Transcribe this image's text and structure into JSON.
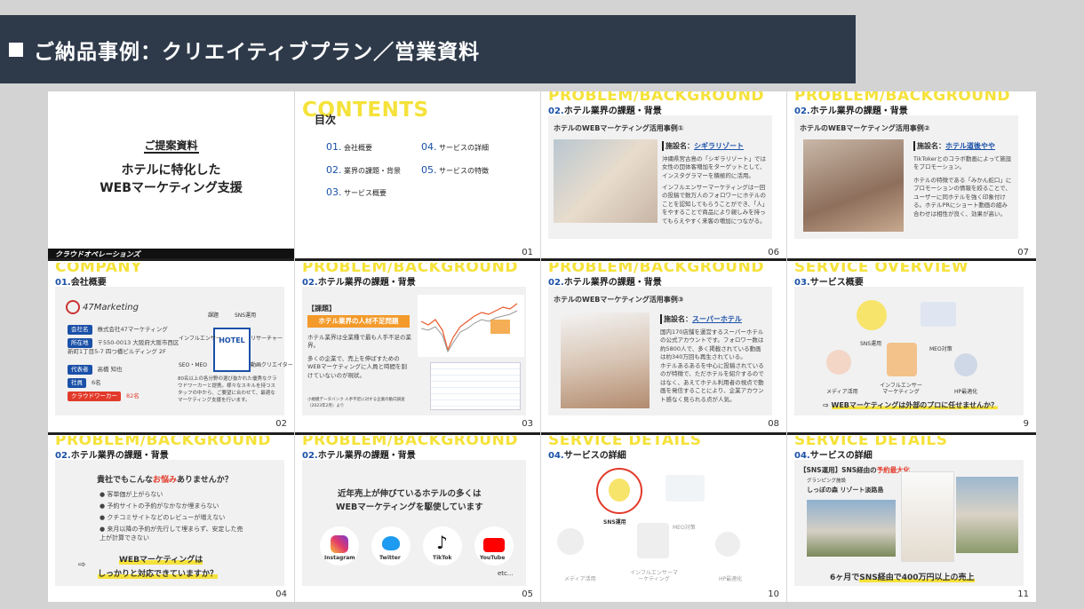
{
  "banner": {
    "title": "ご納品事例：クリエイティブプラン／営業資料"
  },
  "s1": {
    "heading": "ご提案資料",
    "title_line1": "ホテルに特化した",
    "title_line2": "WEBマーケティング支援",
    "logo": "クラウドオペレーションズ"
  },
  "s2": {
    "wm": "CONTENTS",
    "heading": "目次",
    "items": [
      {
        "n": "01.",
        "t": "会社概要"
      },
      {
        "n": "04.",
        "t": "サービスの詳細"
      },
      {
        "n": "02.",
        "t": "業界の課題・背景"
      },
      {
        "n": "05.",
        "t": "サービスの特徴"
      },
      {
        "n": "03.",
        "t": "サービス概要"
      }
    ],
    "page": "01"
  },
  "s3": {
    "wm": "PROBLEM/BACKGROUND",
    "secn": "02.",
    "sec": "ホテル業界の課題・背景",
    "case": "ホテルのWEBマーケティング活用事例①",
    "fname": "施設名：",
    "facility": "シギラリゾート",
    "p1": "沖縄県宮古島の「シギラリゾート」では女性の団体客増加をターゲットとして、インスタグラマーを積極的に活用。",
    "p2": "インフルエンサーマーケティングは一回の投稿で数万人のフォロワーにホテルのことを認知してもらうことができ、「人」をやすることで商品により親しみを持ってもらえやすく来客の増加につながる。",
    "page": "06"
  },
  "s4": {
    "wm": "PROBLEM/BACKGROUND",
    "secn": "02.",
    "sec": "ホテル業界の課題・背景",
    "case": "ホテルのWEBマーケティング活用事例②",
    "fname": "施設名：",
    "facility": "ホテル道後やや",
    "p1": "TikTokerとのコラボ動画によって施設をプロモーション。",
    "p2": "ホテルの特徴である「みかん蛇口」にプロモーションの情報を絞ることで、ユーザーに同ホテルを強く印象付ける。ホテルPRにショート動画の組み合わせは相性が良く、効果が高い。",
    "page": "07"
  },
  "s5": {
    "wm": "COMPANY",
    "secn": "01.",
    "sec": "会社概要",
    "logo": "47Marketing",
    "rows": [
      {
        "k": "会社名",
        "v": "株式会社47マーケティング"
      },
      {
        "k": "所在地",
        "v": "〒550-0013 大阪府大阪市西区新町1丁目5-7 四つ橋ビルディング 2F"
      },
      {
        "k": "代表者",
        "v": "高橋 知也"
      },
      {
        "k": "社員",
        "v": "6名"
      },
      {
        "k": "クラウドワーカー",
        "v": "82名"
      }
    ],
    "hub": "HOTEL",
    "nodes": [
      "課題",
      "SNS運用",
      "インフルエンサー",
      "リサーチャー",
      "SEO・MEO",
      "動画クリエイター"
    ],
    "desc": "80名以上の各分野の選び抜かれた優秀なクラウドワーカーと提携。様々なスキルを持つスタッフの中から、ご要望に合わせて、最適なマーケティング支援を行います。",
    "page": "02"
  },
  "s6": {
    "wm": "PROBLEM/BACKGROUND",
    "secn": "02.",
    "sec": "ホテル業界の課題・背景",
    "tag": "【課題】",
    "issue": "ホテル業界の人材不足問題",
    "p1": "ホテル業界は全業種で最も人手不足の業界。",
    "p2": "多くの企業で、売上を伸ばすためのWEBマーケティングに人員と時間を割けていないのが現状。",
    "source": "小規模データバンク 人手不足に対する企業の動向調査（2023年2月）より",
    "page": "03"
  },
  "s7": {
    "wm": "PROBLEM/BACKGROUND",
    "secn": "02.",
    "sec": "ホテル業界の課題・背景",
    "case": "ホテルのWEBマーケティング活用事例③",
    "fname": "施設名：",
    "facility": "スーパーホテル",
    "p1": "国内170店舗を運営するスーパーホテルの公式アカウントです。フォロワー数は約5800人で、多く掲載されている動画は約340万回も再生されている。",
    "p2": "ホテルあるあるを中心に投稿されているのが特徴で、ただホテルを紹介するのではなく、あえてホテル利用者の視点で動画を発信することにより、企業アカウント感なく見られる点が人気。",
    "page": "08"
  },
  "s8": {
    "wm": "SERVICE OVERVIEW",
    "secn": "03.",
    "sec": "サービス概要",
    "nodes": [
      "SNS運用",
      "MEO対策",
      "メディア活用",
      "インフルエンサーマーケティング",
      "HP最適化"
    ],
    "cta": "WEBマーケティングは外部のプロに任せませんか？",
    "arrow": "⇨",
    "page": "9"
  },
  "s9": {
    "wm": "PROBLEM/BACKGROUND",
    "secn": "02.",
    "sec": "ホテル業界の課題・背景",
    "q_a": "貴社でもこんな",
    "q_b": "お悩み",
    "q_c": "ありませんか？",
    "items": [
      "客単価が上がらない",
      "予約サイトの予約がなかなか埋まらない",
      "クチコミサイトなどのレビューが増えない",
      "来月以降の予約が先行して埋まらず、安定した売上が計算できない"
    ],
    "cta1": "WEBマーケティングは",
    "cta2": "しっかりと対応できていますか？",
    "arrow": "⇨",
    "page": "04"
  },
  "s10": {
    "wm": "PROBLEM/BACKGROUND",
    "secn": "02.",
    "sec": "ホテル業界の課題・背景",
    "h1": "近年売上が伸びているホテルの多くは",
    "h2": "WEBマーケティングを駆使しています",
    "apps": [
      "Instagram",
      "Twitter",
      "TikTok",
      "YouTube"
    ],
    "etc": "etc...",
    "page": "05"
  },
  "s11": {
    "wm": "SERVICE DETAILS",
    "secn": "04.",
    "sec": "サービスの詳細",
    "nodes": [
      "SNS運用",
      "MEO対策",
      "メディア活用",
      "インフルエンサーマーケティング",
      "HP最適化"
    ],
    "page": "10"
  },
  "s12": {
    "wm": "SERVICE DETAILS",
    "secn": "04.",
    "sec": "サービスの詳細",
    "head_a": "【SNS運用】SNS経由の",
    "head_b": "予約最大化",
    "sub1": "グランピング施設",
    "sub2": "しっぽの森 リゾート淡路島",
    "foot_a": "6ヶ月で",
    "foot_b": "SNS経由で400万円以上の売上",
    "page": "11"
  },
  "colors": {
    "banner": "#2e3a4a",
    "accent_yellow": "#f5e23a",
    "blue": "#1a50a8",
    "red": "#e23a2a",
    "orange": "#f39a2a"
  }
}
